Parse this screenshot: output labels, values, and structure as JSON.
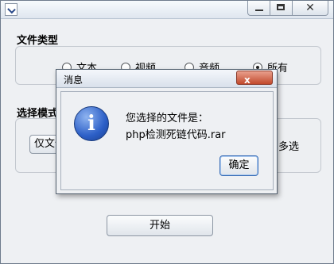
{
  "window": {
    "icon": "java-app-icon"
  },
  "file_type": {
    "title": "文件类型",
    "options": [
      {
        "label": "文本",
        "selected": false
      },
      {
        "label": "视频",
        "selected": false
      },
      {
        "label": "音频",
        "selected": false
      },
      {
        "label": "所有",
        "selected": true
      }
    ]
  },
  "select_mode": {
    "title": "选择模式",
    "left_button_partial": "仅文件",
    "right_partial": "多选"
  },
  "start_button": "开始",
  "dialog": {
    "title": "消息",
    "close_symbol": "x",
    "line1": "您选择的文件是：",
    "line2": "php检测死链代码.rar",
    "ok_button": "确定",
    "icon": "info-icon"
  }
}
